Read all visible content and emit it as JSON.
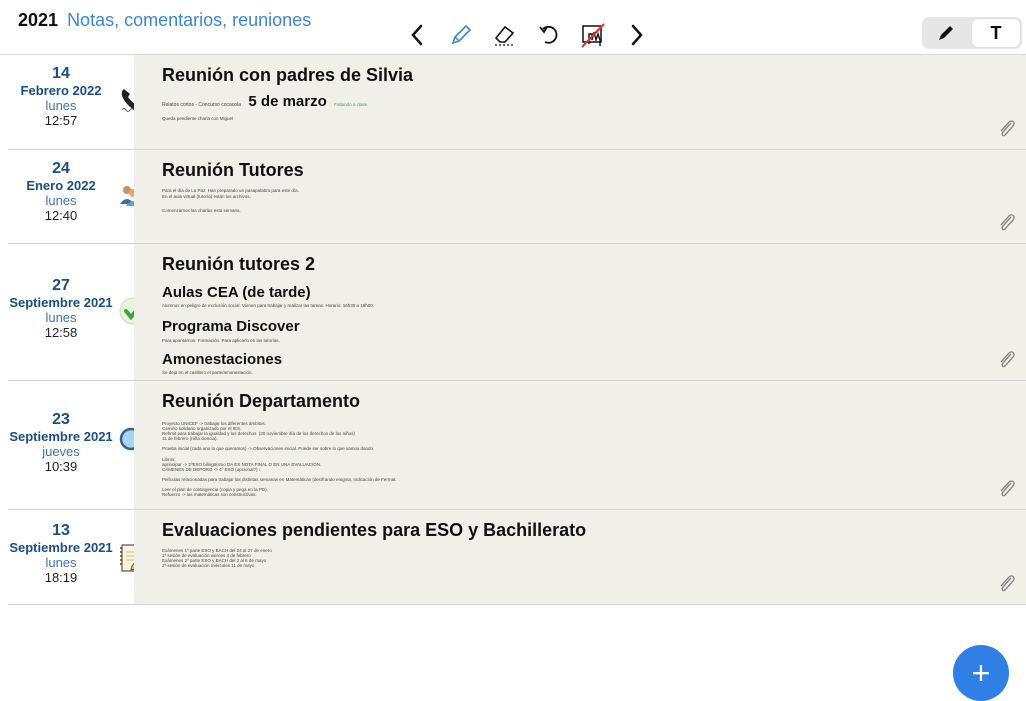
{
  "header": {
    "year": "2021",
    "subtitle": "Notas, comentarios, reuniones",
    "mode_text_label": "T",
    "icons": [
      "chevron-left-icon",
      "pencil-icon",
      "eraser-icon",
      "undo-icon",
      "hand-crossed-icon",
      "chevron-right-icon"
    ]
  },
  "entries": [
    {
      "day": "14",
      "month": "Febrero 2022",
      "weekday": "lunes",
      "time": "12:57",
      "icon": "phone-icon",
      "title": "Reunión con padres de Silvia",
      "line1_small": "Relatos cortos - Concurso cocacola",
      "line1_big": "5 de marzo",
      "line1_green": "Faltando a clase.",
      "line2_small": "Queda pendiente charla con Miguel"
    },
    {
      "day": "24",
      "month": "Enero 2022",
      "weekday": "lunes",
      "time": "12:40",
      "icon": "people-icon",
      "title": "Reunión Tutores",
      "notes": [
        "Para el día de La Paz. Han preparado un pasapalabra para este día.",
        "En el aula virtual (tutoría) están los archivos.",
        "Comenzamos las charlas esta semana."
      ]
    },
    {
      "day": "27",
      "month": "Septiembre 2021",
      "weekday": "lunes",
      "time": "12:58",
      "icon": "checkmark-icon",
      "title": "Reunión tutores 2",
      "sections": [
        {
          "heading": "Aulas CEA (de tarde)",
          "text": "Alumnos en peligro de exclusión social. Vienen para trabajar y realizar las tareas. Horario: 16h30 a 19h00."
        },
        {
          "heading": "Programa Discover",
          "text": "Para apuntarnos. Formación. Para aplicarlo en las tutorías."
        },
        {
          "heading": "Amonestaciones",
          "text": "Se deja en el casillero el parte/amonestación."
        }
      ]
    },
    {
      "day": "23",
      "month": "Septiembre 2021",
      "weekday": "jueves",
      "time": "10:39",
      "icon": "magnifier-icon",
      "title": "Reunión Departamento",
      "notes": [
        "Proyecto UNICEF -> trabajar los diferentes ámbitos.",
        "Camino solidario organizado por el IES.",
        "Rehmit para trabajar la igualdad y los derechos. (20 noviembre día de los derechos de los niños)",
        "11 de febrero (niña ciencia).",
        "Prueba inicial (cada uno la que queramos) -> Observaciones inicial. Puede ser sobre lo que vamos dando.",
        "Libros:",
        "aprincipar -> 2ºESO bilingüismo DA ES NOTA FINAL O EN UNA EVALUACIÓN.",
        "CÁMENES DE DEPORO -> 4º ESO (opcional?) ↓",
        "Películas relacionadas para trabajar las distintas semanas en Matemáticas (decifrando enigma, Indicación de Fermat.",
        "Leer el plan de contingencia (copia y pega en la PD).",
        "Refuerzo -> las matemáticas son constructivas."
      ]
    },
    {
      "day": "13",
      "month": "Septiembre 2021",
      "weekday": "lunes",
      "time": "18:19",
      "icon": "notepad-icon",
      "title": "Evaluaciones pendientes para ESO y Bachillerato",
      "notes": [
        "Exámenes 1º parte ESO y BACH del 24 al 27 de enero",
        "1ª sesión de evaluación viernes 4 de febrero",
        "Exámenes 2º parte ESO y BACH del 2 al 6 de mayo",
        "2ª sesión de evaluación miércoles 11 de mayo"
      ]
    }
  ],
  "fab_label": "+"
}
